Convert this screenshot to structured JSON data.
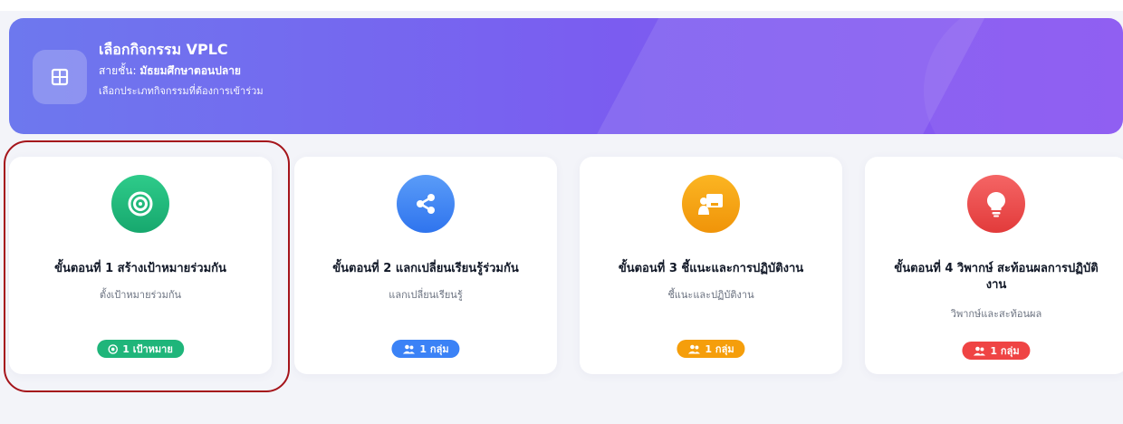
{
  "header": {
    "title": "เลือกกิจกรรม VPLC",
    "level_label": "สายชั้น:",
    "level_value": "มัธยมศึกษาตอนปลาย",
    "description": "เลือกประเภทกิจกรรมที่ต้องการเข้าร่วม",
    "icon": "grid-icon"
  },
  "cards": [
    {
      "title": "ขั้นตอนที่ 1 สร้างเป้าหมายร่วมกัน",
      "subtitle": "ตั้งเป้าหมายร่วมกัน",
      "badge": "1 เป้าหมาย",
      "icon": "target-icon",
      "badge_icon": "target-icon",
      "color": "#1fb57a",
      "selected": true
    },
    {
      "title": "ขั้นตอนที่ 2 แลกเปลี่ยนเรียนรู้ร่วมกัน",
      "subtitle": "แลกเปลี่ยนเรียนรู้",
      "badge": "1 กลุ่ม",
      "icon": "share-icon",
      "badge_icon": "users-icon",
      "color": "#3b82f6"
    },
    {
      "title": "ขั้นตอนที่ 3 ชี้แนะและการปฏิบัติงาน",
      "subtitle": "ชี้แนะและปฏิบัติงาน",
      "badge": "1 กลุ่ม",
      "icon": "presentation-icon",
      "badge_icon": "users-icon",
      "color": "#f59e0b"
    },
    {
      "title": "ขั้นตอนที่ 4 วิพากษ์ สะท้อนผลการปฏิบัติงาน",
      "subtitle": "วิพากษ์และสะท้อนผล",
      "badge": "1 กลุ่ม",
      "icon": "lightbulb-icon",
      "badge_icon": "users-icon",
      "color": "#ef4444"
    }
  ]
}
